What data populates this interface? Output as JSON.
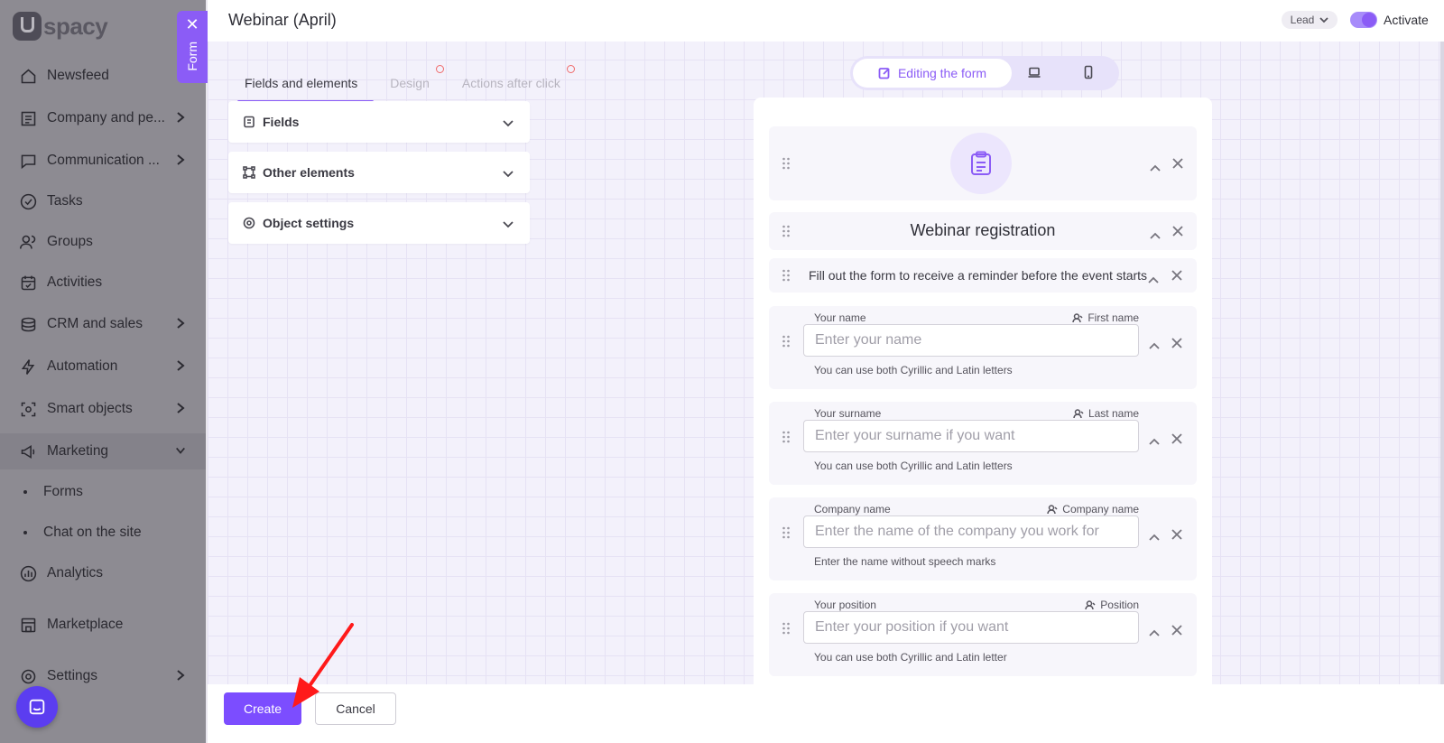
{
  "app": {
    "logo_text": "spacy",
    "title": "Webinar (April)"
  },
  "sidebar": {
    "items": [
      {
        "label": "Newsfeed",
        "icon": "home-icon",
        "chevron": false
      },
      {
        "label": "Company and pe...",
        "icon": "building-icon",
        "chevron": true
      },
      {
        "label": "Communication ...",
        "icon": "chat-icon",
        "chevron": true
      },
      {
        "label": "Tasks",
        "icon": "check-circle-icon",
        "chevron": false
      },
      {
        "label": "Groups",
        "icon": "users-icon",
        "chevron": false
      },
      {
        "label": "Activities",
        "icon": "calendar-icon",
        "chevron": false
      },
      {
        "label": "CRM and sales",
        "icon": "coins-icon",
        "chevron": true
      },
      {
        "label": "Automation",
        "icon": "lightning-icon",
        "chevron": true
      },
      {
        "label": "Smart objects",
        "icon": "scan-icon",
        "chevron": true
      },
      {
        "label": "Marketing",
        "icon": "megaphone-icon",
        "chevron": true,
        "expanded": true
      },
      {
        "label": "Analytics",
        "icon": "chart-icon",
        "chevron": false
      },
      {
        "label": "Marketplace",
        "icon": "store-icon",
        "chevron": false
      },
      {
        "label": "Settings",
        "icon": "gear-icon",
        "chevron": true
      }
    ],
    "sub_items": [
      "Forms",
      "Chat on the site"
    ]
  },
  "form_tab": {
    "label": "Form"
  },
  "header": {
    "lead_select": "Lead",
    "activate_label": "Activate",
    "activated": true
  },
  "tabs": [
    {
      "label": "Fields and elements",
      "active": true
    },
    {
      "label": "Design",
      "active": false,
      "warning": true
    },
    {
      "label": "Actions after click",
      "active": false,
      "warning": true
    }
  ],
  "panels": [
    {
      "label": "Fields",
      "icon": "fields-icon"
    },
    {
      "label": "Other elements",
      "icon": "elements-icon"
    },
    {
      "label": "Object settings",
      "icon": "settings-icon"
    }
  ],
  "view_switcher": {
    "active_label": "Editing the form"
  },
  "form_preview": {
    "title": "Webinar registration",
    "description": "Fill out the form to receive a reminder before the event starts",
    "fields": [
      {
        "label": "Your name",
        "mapping": "First name",
        "placeholder": "Enter your name",
        "hint": "You can use both Cyrillic and Latin letters"
      },
      {
        "label": "Your surname",
        "mapping": "Last name",
        "placeholder": "Enter your surname if you want",
        "hint": "You can use both Cyrillic and Latin letters"
      },
      {
        "label": "Company name",
        "mapping": "Company name",
        "placeholder": "Enter the name of the company you work for",
        "hint": "Enter the name without speech marks"
      },
      {
        "label": "Your position",
        "mapping": "Position",
        "placeholder": "Enter your position if you want",
        "hint": "You can use both Cyrillic and Latin letter"
      }
    ]
  },
  "footer": {
    "create_label": "Create",
    "cancel_label": "Cancel"
  },
  "colors": {
    "accent": "#8b5cf6",
    "primary_button": "#7c4dff",
    "annotation_arrow": "#ff1a1a"
  }
}
